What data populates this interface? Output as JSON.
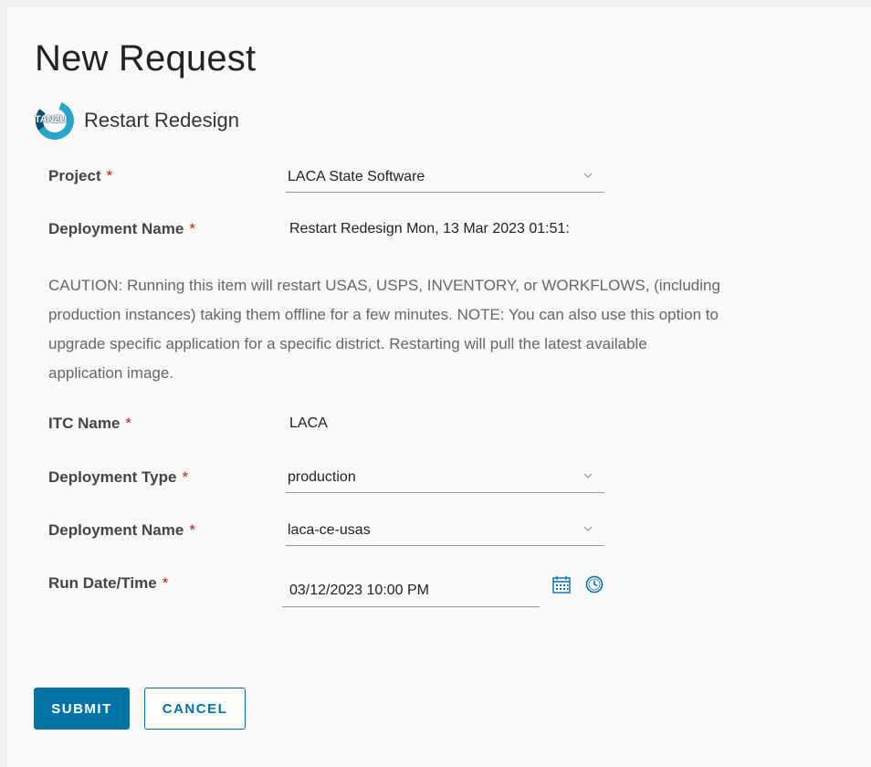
{
  "page": {
    "title": "New Request"
  },
  "catalog_item": {
    "logo_text": "TANZU",
    "name": "Restart Redesign"
  },
  "form": {
    "project": {
      "label": "Project",
      "required": "*",
      "value": "LACA State Software"
    },
    "deployment_name_top": {
      "label": "Deployment Name",
      "required": "*",
      "value": "Restart Redesign Mon, 13 Mar 2023 01:51:"
    },
    "caution": "CAUTION: Running this item will restart USAS, USPS, INVENTORY, or WORKFLOWS, (including production instances) taking them offline for a few minutes. NOTE: You can also use this option to upgrade specific application for a specific district. Restarting will pull the latest available application image.",
    "itc_name": {
      "label": "ITC Name",
      "required": "*",
      "value": "LACA"
    },
    "deployment_type": {
      "label": "Deployment Type",
      "required": "*",
      "value": "production"
    },
    "deployment_name": {
      "label": "Deployment Name",
      "required": "*",
      "value": "laca-ce-usas"
    },
    "run_datetime": {
      "label": "Run Date/Time",
      "required": "*",
      "value": "03/12/2023 10:00 PM"
    }
  },
  "actions": {
    "submit_label": "SUBMIT",
    "cancel_label": "CANCEL"
  },
  "icons": {
    "select_arrow": "chevron-down-icon",
    "calendar": "calendar-icon",
    "clock": "clock-icon"
  },
  "colors": {
    "primary": "#0072a3",
    "required": "#c92100",
    "logo_teal": "#2aa6c9"
  }
}
